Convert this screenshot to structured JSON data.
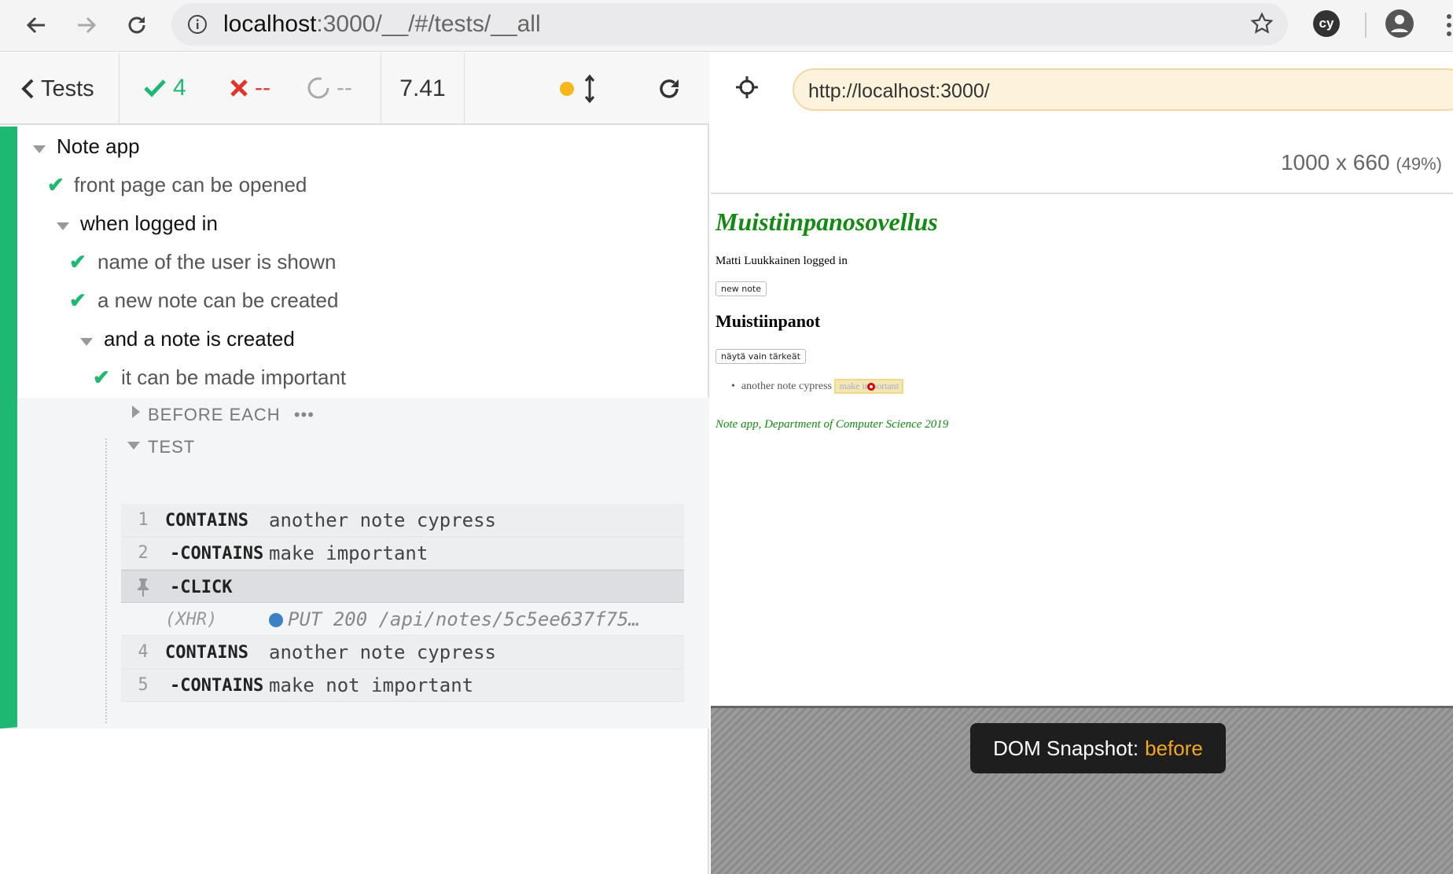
{
  "browser": {
    "url_host": "localhost",
    "url_path": ":3000/__/#/tests/__all",
    "extension_label": "cy"
  },
  "reporter": {
    "tests_label": "Tests",
    "passed_count": "4",
    "failed_count": "--",
    "pending_count": "--",
    "duration": "7.41"
  },
  "runnables": {
    "suite_root": "Note app",
    "test_front_page": "front page can be opened",
    "suite_logged_in": "when logged in",
    "test_name_shown": "name of the user is shown",
    "test_new_note": "a new note can be created",
    "suite_note_created": "and a note is created",
    "test_important": "it can be made important",
    "hook_before_each": "BEFORE EACH",
    "hook_before_each_more": "•••",
    "hook_test": "TEST",
    "commands": [
      {
        "num": "1",
        "name": "CONTAINS",
        "msg": "another note cypress"
      },
      {
        "num": "2",
        "name": "-CONTAINS",
        "msg": "make important"
      },
      {
        "num": "",
        "name": "-CLICK",
        "msg": ""
      },
      {
        "num": "",
        "name": "(XHR)",
        "msg": "PUT 200 /api/notes/5c5ee637f75…"
      },
      {
        "num": "4",
        "name": "CONTAINS",
        "msg": "another note cypress"
      },
      {
        "num": "5",
        "name": "-CONTAINS",
        "msg": "make not important"
      }
    ]
  },
  "aut": {
    "url": "http://localhost:3000/",
    "viewport_size": "1000 x 660",
    "viewport_scale": "(49%)"
  },
  "app": {
    "title": "Muistiinpanosovellus",
    "logged_in": "Matti Luukkainen logged in",
    "new_note_button": "new note",
    "notes_heading": "Muistiinpanot",
    "filter_button": "näytä vain tärkeät",
    "note_text": "another note cypress",
    "note_button": "make important",
    "footer": "Note app, Department of Computer Science 2019"
  },
  "snapshot": {
    "label": "DOM Snapshot:",
    "state": "before"
  },
  "colors": {
    "passed": "#1fb873",
    "failed": "#e0352b",
    "app_green": "#138a13",
    "snapshot_state": "#f5a623"
  }
}
